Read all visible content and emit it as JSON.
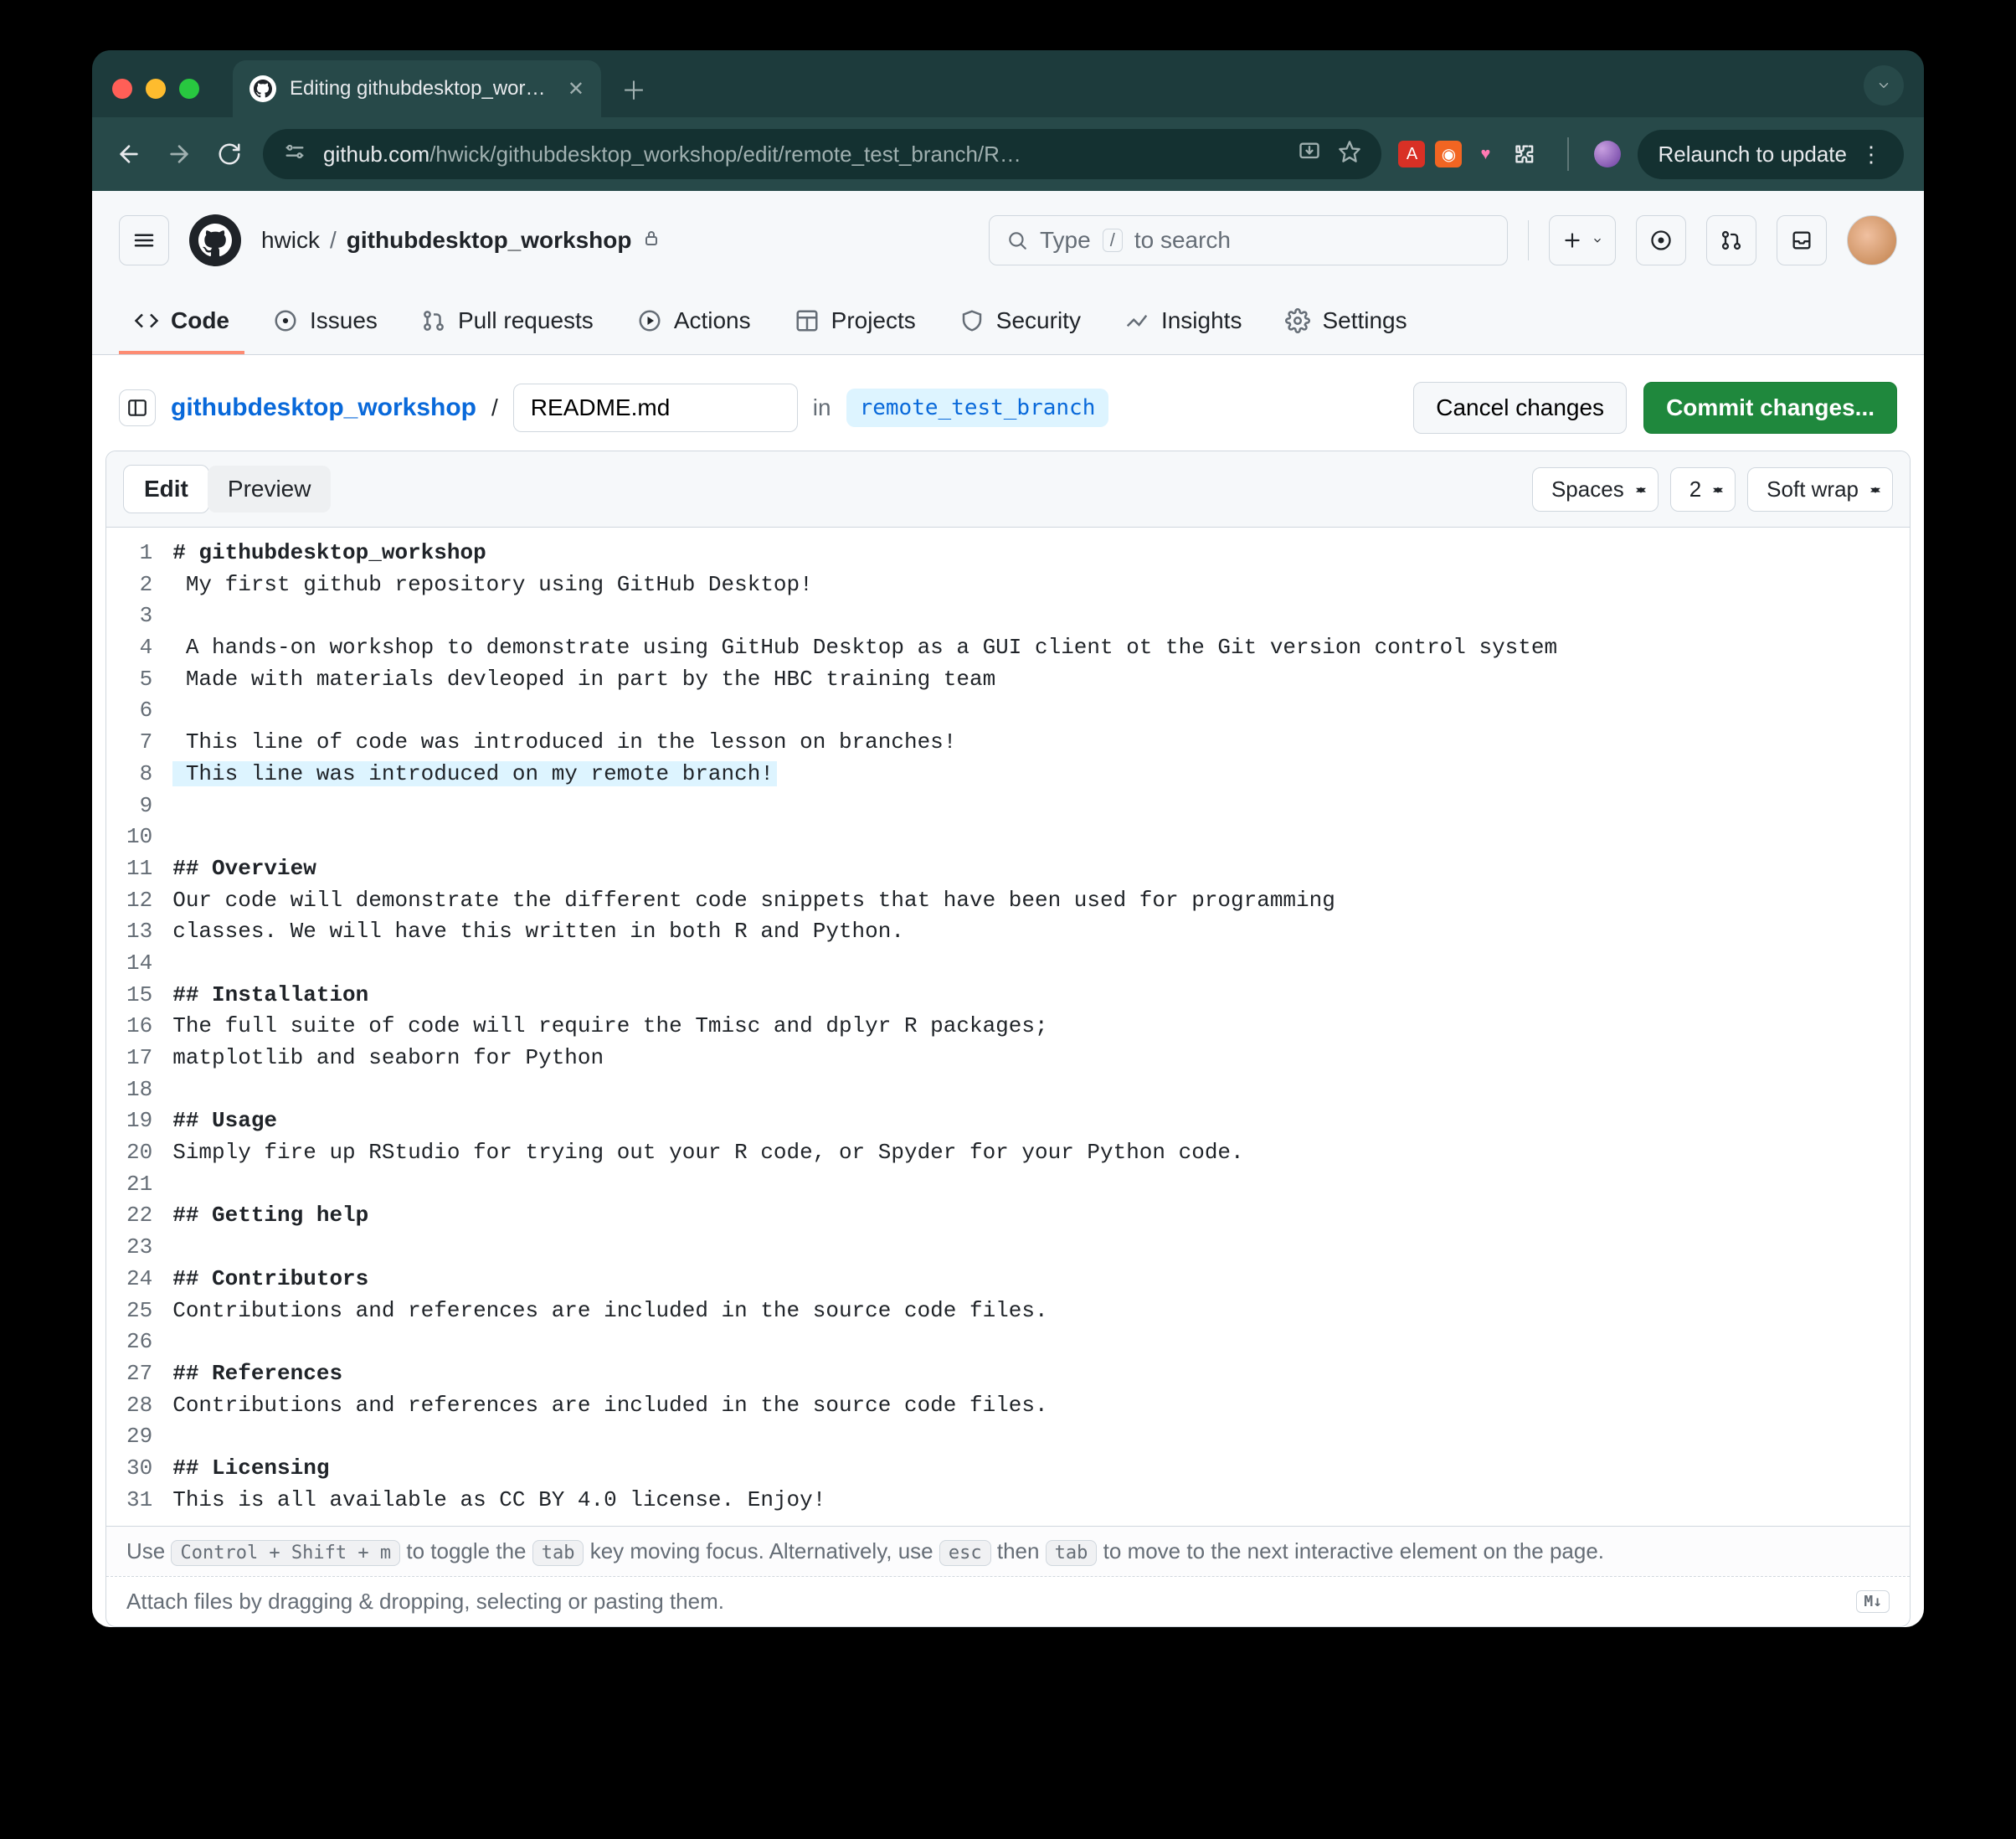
{
  "chrome": {
    "tab_title": "Editing githubdesktop_works…",
    "url_domain": "github.com",
    "url_path": "/hwick/githubdesktop_workshop/edit/remote_test_branch/R…",
    "relaunch_label": "Relaunch to update"
  },
  "gh_header": {
    "owner": "hwick",
    "sep": "/",
    "repo": "githubdesktop_workshop",
    "search_prefix": "Type ",
    "search_slash": "/",
    "search_suffix": " to search"
  },
  "repo_nav": {
    "code": "Code",
    "issues": "Issues",
    "pulls": "Pull requests",
    "actions": "Actions",
    "projects": "Projects",
    "security": "Security",
    "insights": "Insights",
    "settings": "Settings"
  },
  "editor_head": {
    "repo_link": "githubdesktop_workshop",
    "sep": "/",
    "filename": "README.md",
    "in": "in",
    "branch": "remote_test_branch",
    "cancel": "Cancel changes",
    "commit": "Commit changes..."
  },
  "editor_tabs": {
    "edit": "Edit",
    "preview": "Preview",
    "indent_mode": "Spaces",
    "indent_size": "2",
    "wrap": "Soft wrap"
  },
  "code": {
    "lines": [
      "# githubdesktop_workshop",
      " My first github repository using GitHub Desktop!",
      "",
      " A hands-on workshop to demonstrate using GitHub Desktop as a GUI client ot the Git version control system",
      " Made with materials devleoped in part by the HBC training team",
      "",
      " This line of code was introduced in the lesson on branches!",
      " This line was introduced on my remote branch!",
      "",
      "",
      "## Overview",
      "Our code will demonstrate the different code snippets that have been used for programming",
      "classes. We will have this written in both R and Python.",
      "",
      "## Installation",
      "The full suite of code will require the Tmisc and dplyr R packages;",
      "matplotlib and seaborn for Python",
      "",
      "## Usage",
      "Simply fire up RStudio for trying out your R code, or Spyder for your Python code.",
      "",
      "## Getting help",
      "",
      "## Contributors",
      "Contributions and references are included in the source code files.",
      "",
      "## References",
      "Contributions and references are included in the source code files.",
      "",
      "## Licensing",
      "This is all available as CC BY 4.0 license. Enjoy!"
    ],
    "highlighted_line_index": 7
  },
  "hint": {
    "pre": "Use ",
    "kbd1": "Control + Shift + m",
    "mid1": " to toggle the ",
    "kbd2": "tab",
    "mid2": " key moving focus. Alternatively, use ",
    "kbd3": "esc",
    "mid3": " then ",
    "kbd4": "tab",
    "post": " to move to the next interactive element on the page."
  },
  "attach": {
    "text": "Attach files by dragging & dropping, selecting or pasting them.",
    "md_badge": "M↓"
  }
}
